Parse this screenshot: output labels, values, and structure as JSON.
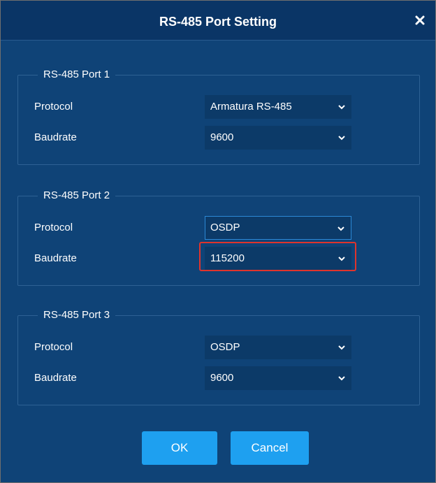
{
  "dialog": {
    "title": "RS-485 Port Setting",
    "close_icon": "close-icon",
    "ports": [
      {
        "legend": "RS-485 Port 1",
        "protocol_label": "Protocol",
        "protocol_value": "Armatura RS-485",
        "baudrate_label": "Baudrate",
        "baudrate_value": "9600"
      },
      {
        "legend": "RS-485 Port 2",
        "protocol_label": "Protocol",
        "protocol_value": "OSDP",
        "baudrate_label": "Baudrate",
        "baudrate_value": "115200"
      },
      {
        "legend": "RS-485 Port 3",
        "protocol_label": "Protocol",
        "protocol_value": "OSDP",
        "baudrate_label": "Baudrate",
        "baudrate_value": "9600"
      }
    ],
    "ok_label": "OK",
    "cancel_label": "Cancel"
  },
  "colors": {
    "background": "#0f4377",
    "titlebar": "#0a3566",
    "button": "#1ea0f0",
    "highlight": "#e0342c"
  }
}
